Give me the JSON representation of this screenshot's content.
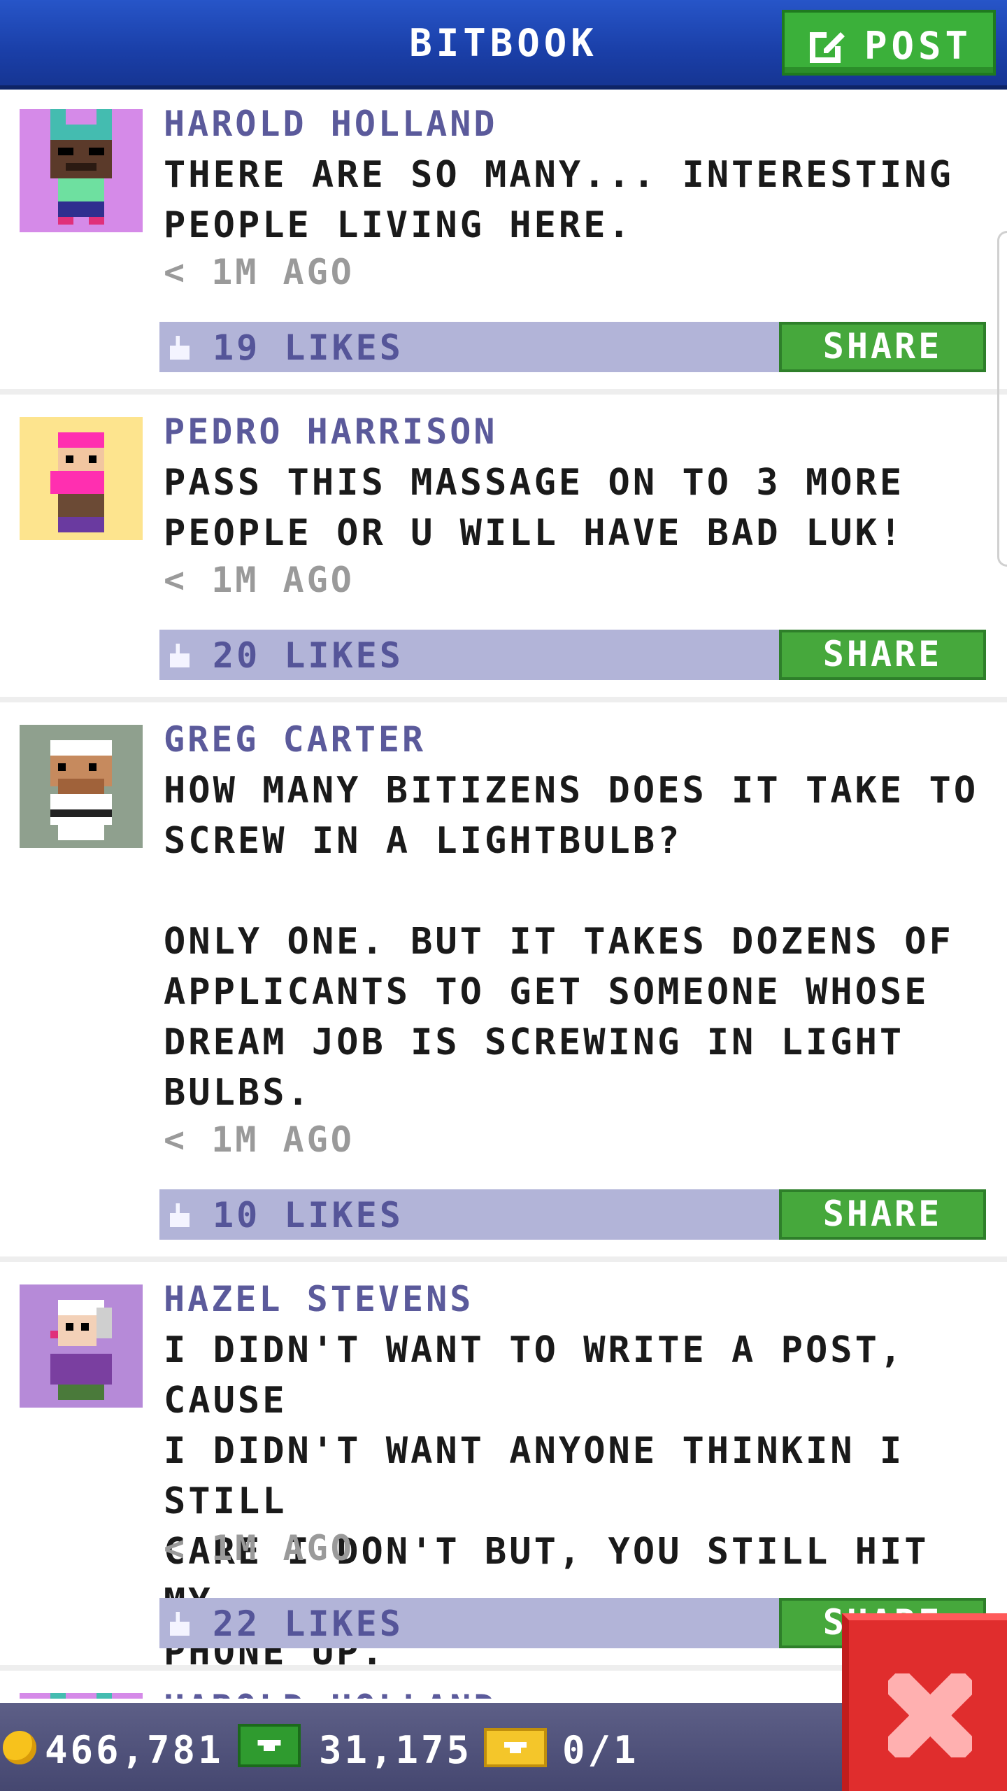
{
  "header": {
    "title": "BITBOOK",
    "post_label": "POST"
  },
  "posts": [
    {
      "name": "HAROLD HOLLAND",
      "body": "THERE ARE SO MANY... INTERESTING\nPEOPLE LIVING HERE.",
      "time": "< 1M AGO",
      "likes": "19 LIKES",
      "share_label": "SHARE",
      "avatar_bg": "#d58ae8"
    },
    {
      "name": "PEDRO HARRISON",
      "body": "PASS THIS MASSAGE ON TO 3 MORE\nPEOPLE OR U WILL HAVE BAD LUK!",
      "time": "< 1M AGO",
      "likes": "20 LIKES",
      "share_label": "SHARE",
      "avatar_bg": "#fde48e"
    },
    {
      "name": "GREG CARTER",
      "body": "HOW MANY BITIZENS DOES IT TAKE TO\nSCREW IN A LIGHTBULB?\n\nONLY ONE. BUT IT TAKES DOZENS OF\nAPPLICANTS TO GET SOMEONE WHOSE\nDREAM JOB IS SCREWING IN LIGHT\nBULBS.",
      "time": "< 1M AGO",
      "likes": "10 LIKES",
      "share_label": "SHARE",
      "avatar_bg": "#8fa08e"
    },
    {
      "name": "HAZEL STEVENS",
      "body": "I DIDN'T WANT TO WRITE A POST, CAUSE\nI DIDN'T WANT ANYONE THINKIN I STILL\nCARE I DON'T BUT, YOU STILL HIT MY\nPHONE UP.",
      "time": "< 1M AGO",
      "likes": "22 LIKES",
      "share_label": "SHARE",
      "avatar_bg": "#b68ad8"
    },
    {
      "name": "HAROLD HOLLAND",
      "avatar_bg": "#d58ae8"
    }
  ],
  "footer": {
    "coins": "466,781",
    "bux": "31,175",
    "tickets": "0/1"
  },
  "colors": {
    "header": "#1f4bbd",
    "post_button": "#3bb03a",
    "share": "#46a83c",
    "like_bar": "#b2b4d8",
    "name": "#5b5a9b",
    "close": "#e02d2d"
  }
}
